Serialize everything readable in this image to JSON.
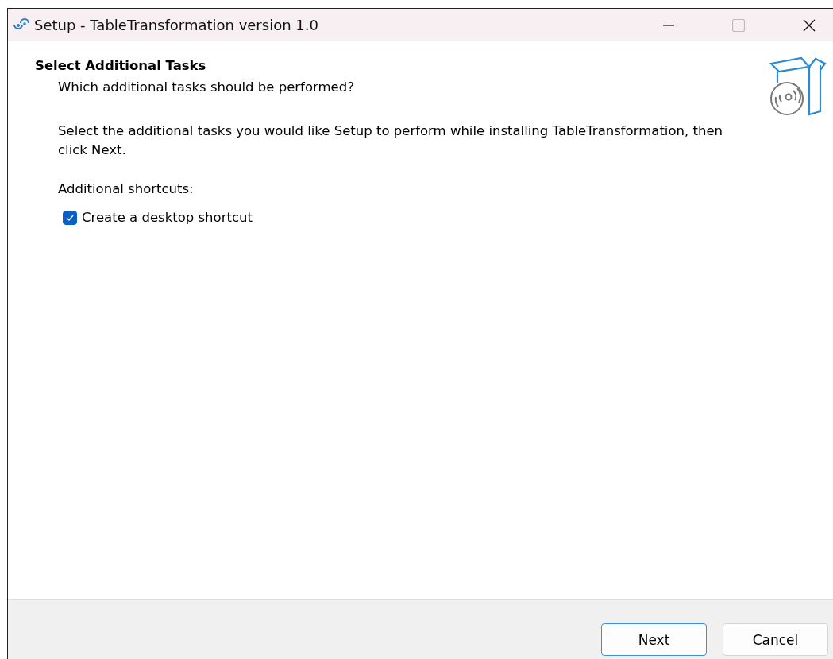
{
  "window": {
    "title": "Setup - TableTransformation version 1.0"
  },
  "header": {
    "title": "Select Additional Tasks",
    "subtitle": "Which additional tasks should be performed?"
  },
  "description": "Select the additional tasks you would like Setup to perform while installing TableTransformation, then click Next.",
  "group_label": "Additional shortcuts:",
  "tasks": [
    {
      "label": "Create a desktop shortcut",
      "checked": true
    }
  ],
  "buttons": [
    {
      "label": "Next",
      "selected": true
    },
    {
      "label": "Cancel",
      "selected": false
    }
  ]
}
